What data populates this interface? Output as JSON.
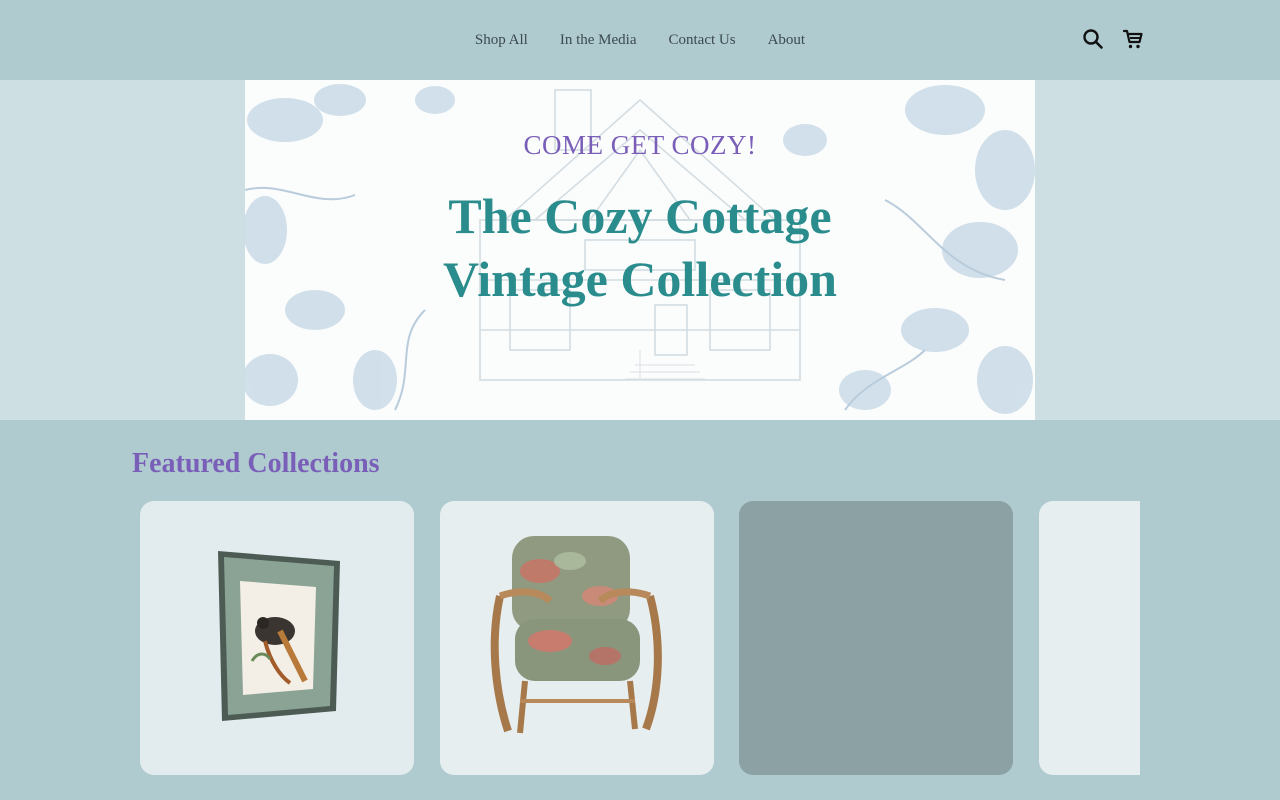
{
  "nav": {
    "items": [
      {
        "label": "Shop All"
      },
      {
        "label": "In the Media"
      },
      {
        "label": "Contact Us"
      },
      {
        "label": "About"
      }
    ],
    "icons": [
      "search-icon",
      "cart-icon"
    ]
  },
  "hero": {
    "eyebrow": "COME GET COZY!",
    "title_line1": "The Cozy Cottage",
    "title_line2": "Vintage Collection"
  },
  "featured": {
    "title": "Featured Collections",
    "cards": [
      {
        "image": "framed-bird-print"
      },
      {
        "image": "rattan-armchair"
      },
      {
        "image": "empty"
      },
      {
        "image": "partial"
      }
    ]
  },
  "colors": {
    "header_bg": "#b0cbd0",
    "hero_band": "#cddfe2",
    "accent_purple": "#7a5fb8",
    "accent_teal": "#2a8c8c"
  }
}
